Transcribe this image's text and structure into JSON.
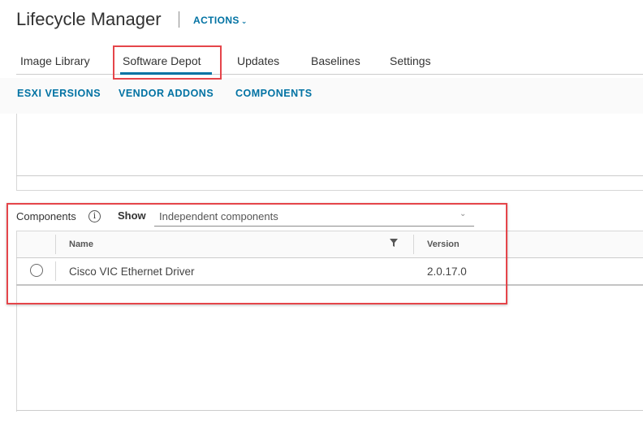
{
  "header": {
    "title": "Lifecycle Manager",
    "actions_label": "ACTIONS",
    "actions_chevron": "⌄"
  },
  "tabs": [
    {
      "label": "Image Library"
    },
    {
      "label": "Software Depot",
      "active": true
    },
    {
      "label": "Updates"
    },
    {
      "label": "Baselines"
    },
    {
      "label": "Settings"
    }
  ],
  "subnav": [
    {
      "label": "ESXI VERSIONS"
    },
    {
      "label": "VENDOR ADDONS"
    },
    {
      "label": "COMPONENTS"
    }
  ],
  "components_section": {
    "label": "Components",
    "info_icon": "i",
    "show_label": "Show",
    "show_select": {
      "value": "Independent components",
      "chevron": "⌄"
    },
    "grid": {
      "columns": [
        "Name",
        "Version"
      ],
      "rows": [
        {
          "name": "Cisco VIC Ethernet Driver",
          "version": "2.0.17.0",
          "selected": false
        }
      ]
    }
  },
  "colors": {
    "accent": "#0072a3",
    "highlight": "#e5454a"
  }
}
